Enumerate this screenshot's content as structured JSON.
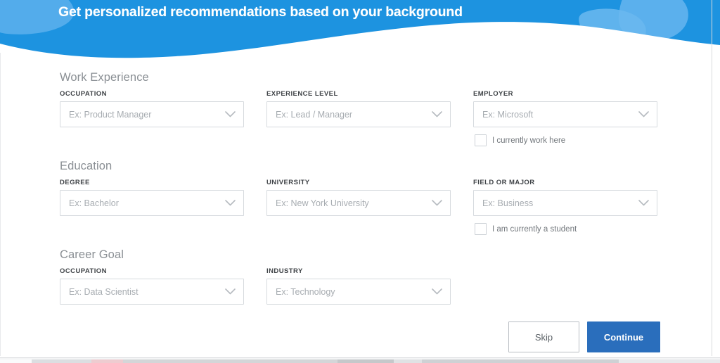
{
  "header": {
    "title": "Get personalized recommendations based on your background",
    "bg_color": "#1d93e0",
    "blob_color": "#63b4ee",
    "wave_color": "#ffffff"
  },
  "sections": [
    {
      "id": "work-experience",
      "title": "Work Experience",
      "fields": [
        {
          "id": "occupation",
          "label": "OCCUPATION",
          "placeholder": "Ex: Product Manager",
          "value": "",
          "icon": "chevron-down-icon"
        },
        {
          "id": "experience-level",
          "label": "EXPERIENCE LEVEL",
          "placeholder": "Ex: Lead / Manager",
          "value": "",
          "icon": "chevron-down-icon"
        },
        {
          "id": "employer",
          "label": "EMPLOYER",
          "placeholder": "Ex: Microsoft",
          "value": "",
          "icon": "chevron-down-icon"
        }
      ],
      "checkbox": {
        "id": "currently-work-here",
        "label": "I currently work here",
        "checked": false
      }
    },
    {
      "id": "education",
      "title": "Education",
      "fields": [
        {
          "id": "degree",
          "label": "DEGREE",
          "placeholder": "Ex: Bachelor",
          "value": "",
          "icon": "chevron-down-icon"
        },
        {
          "id": "university",
          "label": "UNIVERSITY",
          "placeholder": "Ex: New York University",
          "value": "",
          "icon": "chevron-down-icon"
        },
        {
          "id": "field-or-major",
          "label": "FIELD OR MAJOR",
          "placeholder": "Ex: Business",
          "value": "",
          "icon": "chevron-down-icon"
        }
      ],
      "checkbox": {
        "id": "currently-a-student",
        "label": "I am currently a student",
        "checked": false
      }
    },
    {
      "id": "career-goal",
      "title": "Career Goal",
      "fields": [
        {
          "id": "goal-occupation",
          "label": "OCCUPATION",
          "placeholder": "Ex: Data Scientist",
          "value": "",
          "icon": "chevron-down-icon"
        },
        {
          "id": "industry",
          "label": "INDUSTRY",
          "placeholder": "Ex: Technology",
          "value": "",
          "icon": "chevron-down-icon"
        }
      ],
      "checkbox": null
    }
  ],
  "footer": {
    "skip_label": "Skip",
    "continue_label": "Continue",
    "continue_color": "#2a6ebc",
    "skip_border_color": "#b9bec3"
  }
}
